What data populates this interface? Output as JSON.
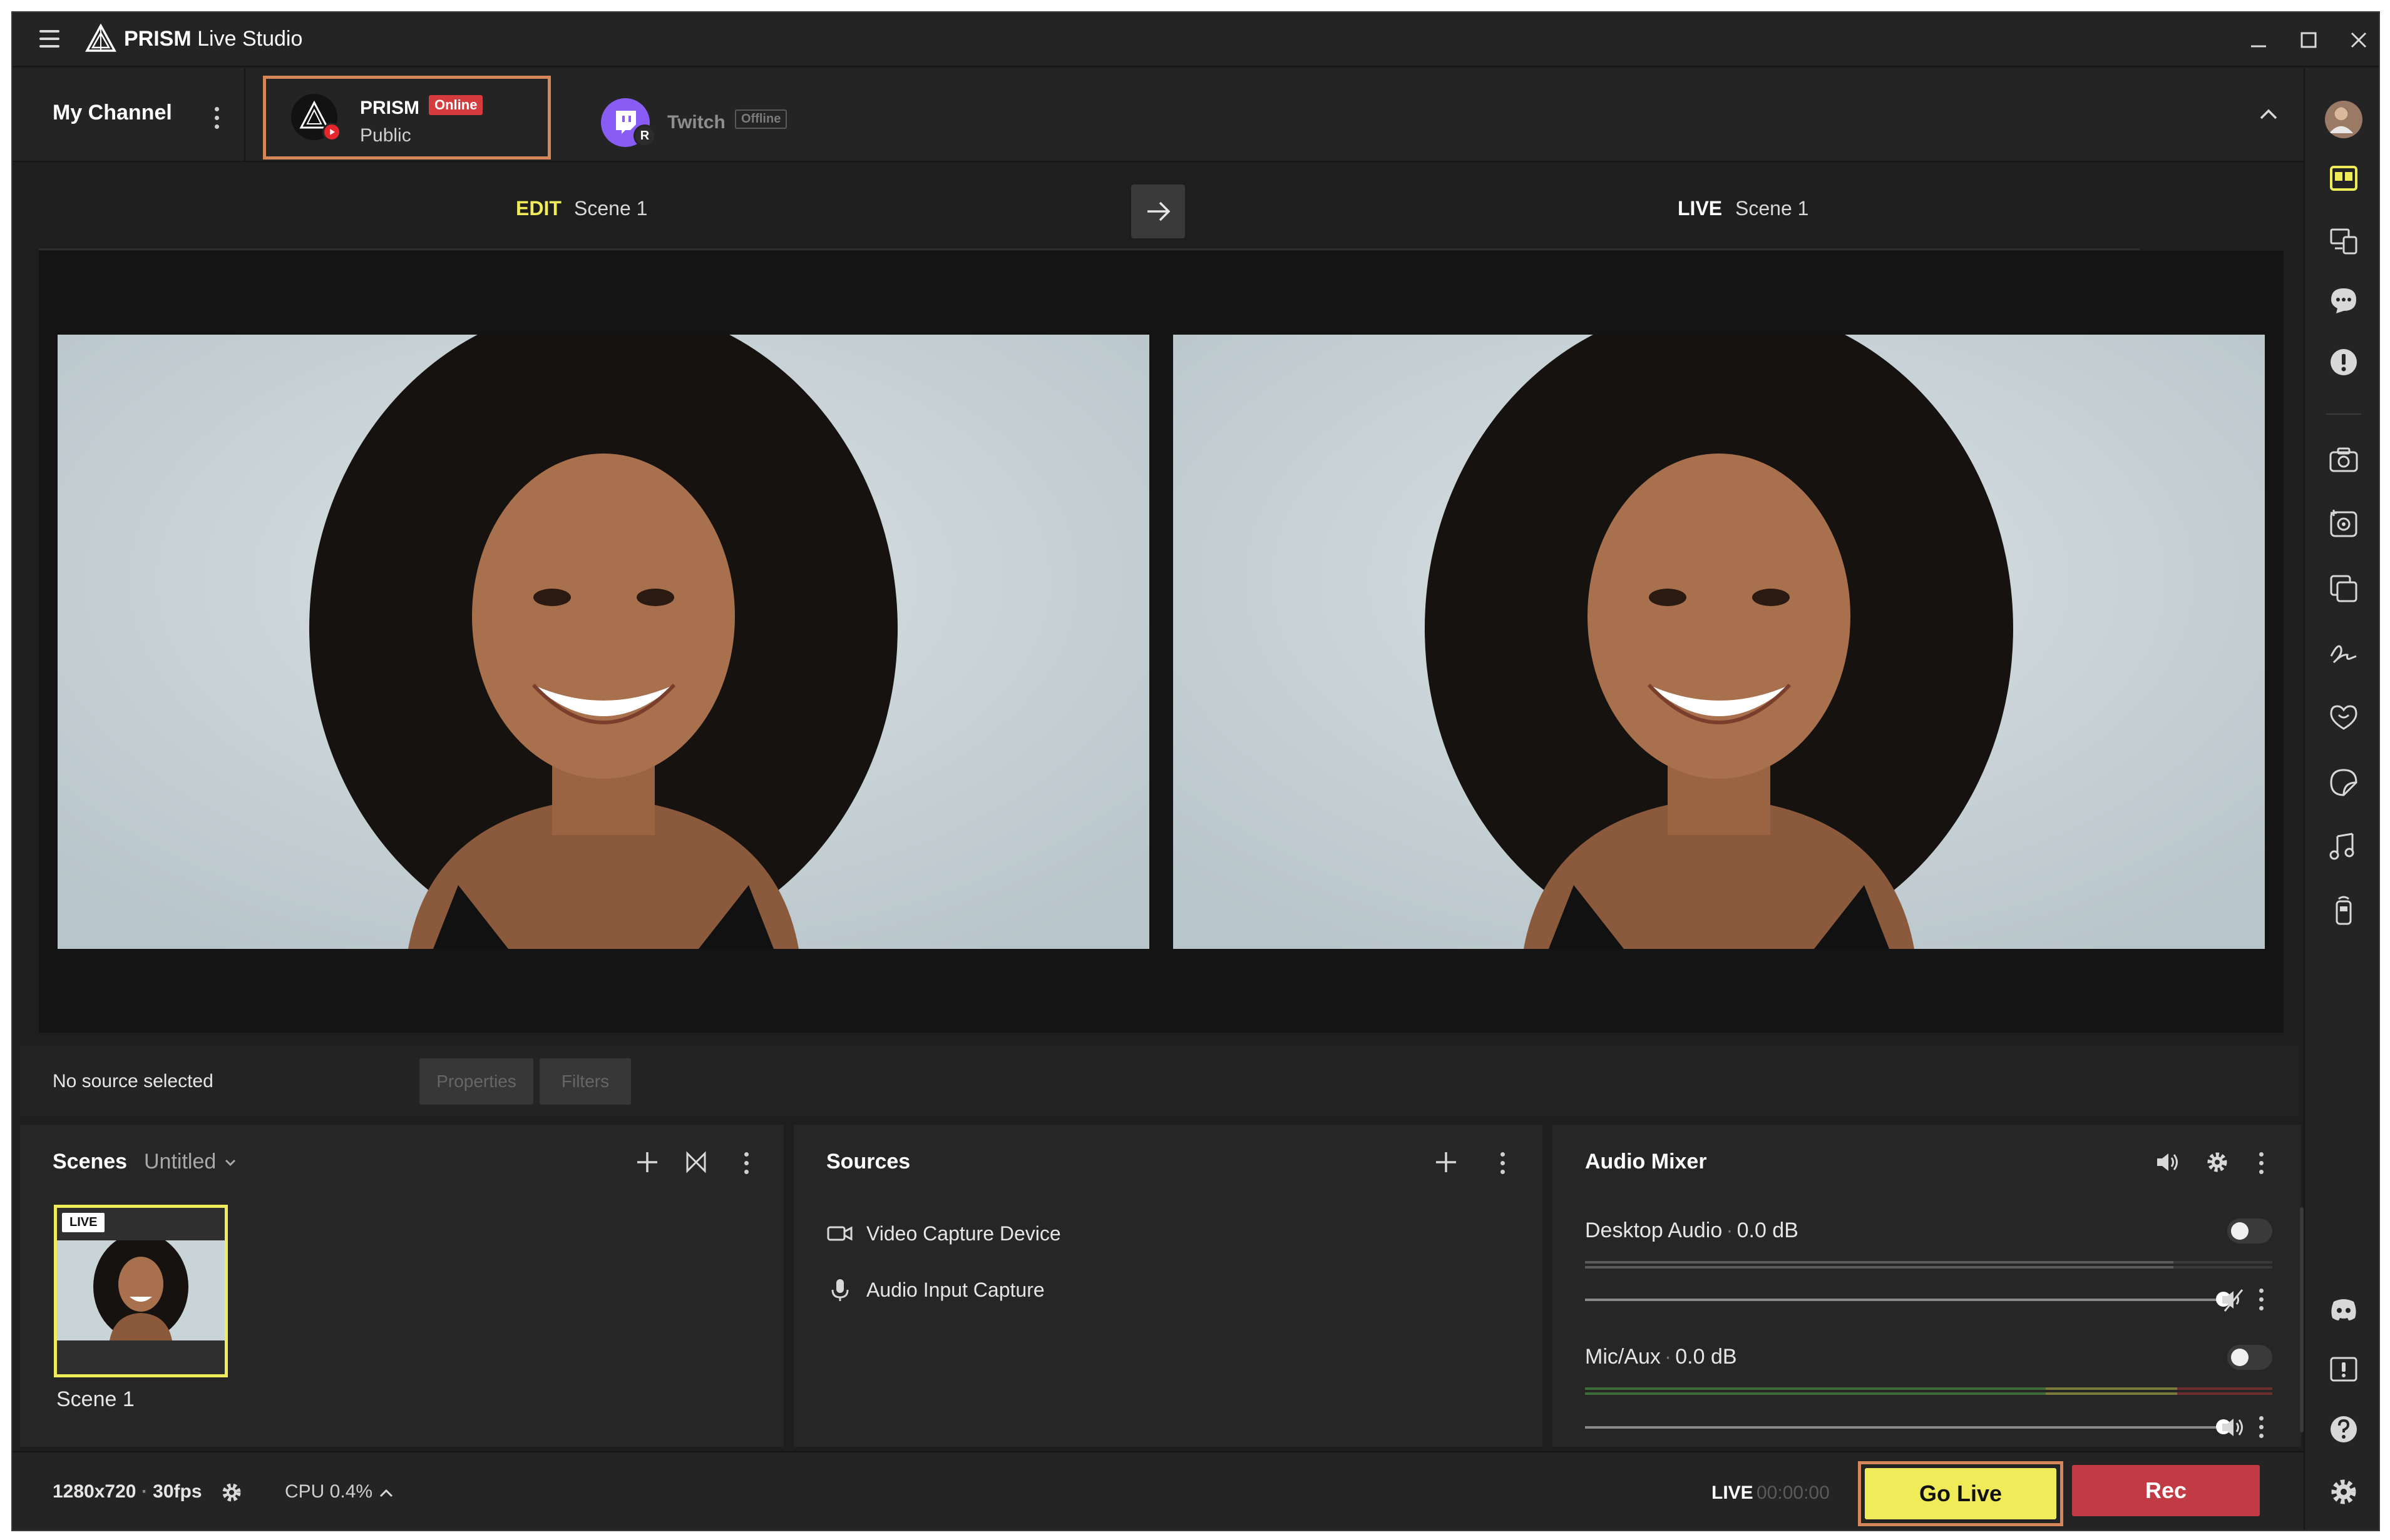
{
  "app": {
    "title_bold": "PRISM",
    "title_rest": " Live Studio"
  },
  "channels": {
    "my_channel_label": "My Channel",
    "prism": {
      "name": "PRISM",
      "status": "Online",
      "visibility": "Public"
    },
    "twitch": {
      "name": "Twitch",
      "status": "Offline",
      "avatar_badge": "R"
    }
  },
  "preview": {
    "edit_label": "EDIT",
    "edit_scene": "Scene 1",
    "live_label": "LIVE",
    "live_scene": "Scene 1"
  },
  "source_toolbar": {
    "status": "No source selected",
    "properties_label": "Properties",
    "filters_label": "Filters"
  },
  "scenes": {
    "title": "Scenes",
    "collection": "Untitled",
    "items": [
      {
        "name": "Scene 1",
        "badge": "LIVE"
      }
    ]
  },
  "sources": {
    "title": "Sources",
    "items": [
      {
        "label": "Video Capture Device",
        "icon": "camera-icon"
      },
      {
        "label": "Audio Input Capture",
        "icon": "microphone-icon"
      }
    ]
  },
  "audio_mixer": {
    "title": "Audio Mixer",
    "channels": [
      {
        "name": "Desktop Audio",
        "level": "0.0 dB",
        "enabled": false,
        "muted": true,
        "volume": 1.0
      },
      {
        "name": "Mic/Aux",
        "level": "0.0 dB",
        "enabled": false,
        "muted": false,
        "volume": 1.0
      }
    ]
  },
  "status": {
    "resolution": "1280x720",
    "separator": "·",
    "fps": "30fps",
    "cpu": "CPU 0.4%",
    "live_label": "LIVE",
    "timer": "00:00:00",
    "go_live_label": "Go Live",
    "rec_label": "Rec"
  },
  "colors": {
    "accent_yellow": "#f0eb58",
    "rec_red": "#c23a43",
    "highlight_orange": "#d6875a",
    "online_red": "#d63b3e",
    "twitch_purple": "#8a5cf6"
  },
  "sidebar_icons": [
    "avatar",
    "layout-icon",
    "devices-icon",
    "chat-icon",
    "alert-icon",
    "camera-icon",
    "capture-icon",
    "overlay-icon",
    "signature-icon",
    "heart-chat-icon",
    "sticker-icon",
    "music-icon",
    "remote-icon",
    "discord-icon",
    "notice-icon",
    "help-icon",
    "settings-icon"
  ]
}
